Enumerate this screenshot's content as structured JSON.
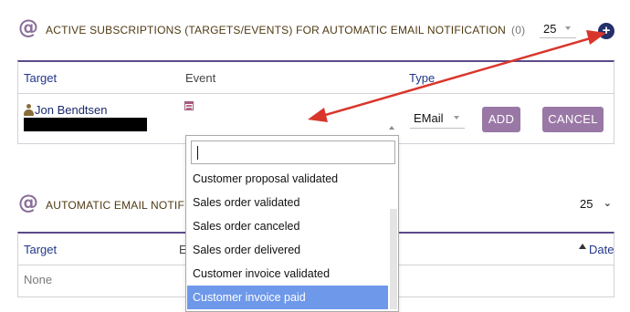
{
  "section1": {
    "title": "ACTIVE SUBSCRIPTIONS (TARGETS/EVENTS) FOR AUTOMATIC EMAIL NOTIFICATION",
    "count": "(0)",
    "page_size": "25",
    "icon": "at-icon",
    "add_icon": "plus-circle-icon",
    "table": {
      "headers": {
        "target": "Target",
        "event": "Event",
        "type": "Type"
      },
      "row": {
        "target_name": "Jon Bendtsen",
        "type_value": "EMail",
        "add_label": "ADD",
        "cancel_label": "CANCEL"
      }
    }
  },
  "dropdown": {
    "search_value": "",
    "items": [
      "Customer proposal validated",
      "Sales order validated",
      "Sales order canceled",
      "Sales order delivered",
      "Customer invoice validated",
      "Customer invoice paid"
    ],
    "highlighted_index": 5
  },
  "section2": {
    "title": "AUTOMATIC EMAIL NOTIFIC",
    "page_size": "25",
    "icon": "at-icon",
    "table": {
      "headers": {
        "target": "Target",
        "event_partial": "E",
        "date": "Date"
      },
      "empty_text": "None"
    }
  },
  "colors": {
    "accent_purple": "#9a78a6",
    "header_link": "#21368c",
    "highlight": "#6e98ea",
    "annotation_arrow": "#d9362b"
  }
}
